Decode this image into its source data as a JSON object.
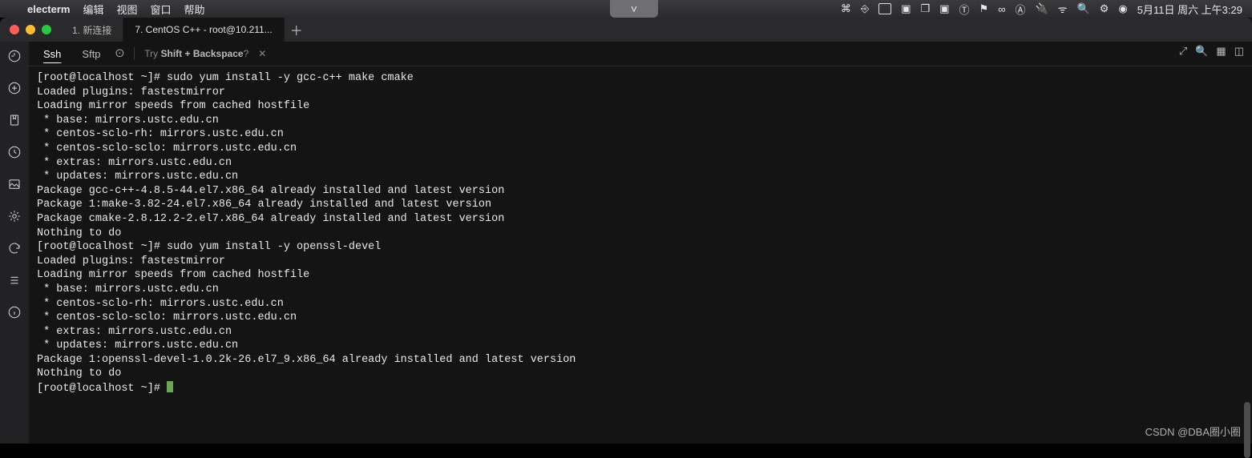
{
  "menubar": {
    "app_name": "electerm",
    "items": [
      "编辑",
      "视图",
      "窗口",
      "帮助"
    ],
    "datetime": "5月11日 周六 上午3:29"
  },
  "window": {
    "tabs": [
      {
        "label": "1. 新连接",
        "active": false
      },
      {
        "label": "7. CentOS C++ - root@10.211...",
        "active": true
      }
    ]
  },
  "toolbar": {
    "tabs": {
      "ssh": "Ssh",
      "sftp": "Sftp"
    },
    "hint_pre": "Try ",
    "hint_key": "Shift + Backspace",
    "hint_post": "?"
  },
  "terminal": {
    "lines": [
      "[root@localhost ~]# sudo yum install -y gcc-c++ make cmake",
      "Loaded plugins: fastestmirror",
      "Loading mirror speeds from cached hostfile",
      " * base: mirrors.ustc.edu.cn",
      " * centos-sclo-rh: mirrors.ustc.edu.cn",
      " * centos-sclo-sclo: mirrors.ustc.edu.cn",
      " * extras: mirrors.ustc.edu.cn",
      " * updates: mirrors.ustc.edu.cn",
      "Package gcc-c++-4.8.5-44.el7.x86_64 already installed and latest version",
      "Package 1:make-3.82-24.el7.x86_64 already installed and latest version",
      "Package cmake-2.8.12.2-2.el7.x86_64 already installed and latest version",
      "Nothing to do",
      "[root@localhost ~]# sudo yum install -y openssl-devel",
      "Loaded plugins: fastestmirror",
      "Loading mirror speeds from cached hostfile",
      " * base: mirrors.ustc.edu.cn",
      " * centos-sclo-rh: mirrors.ustc.edu.cn",
      " * centos-sclo-sclo: mirrors.ustc.edu.cn",
      " * extras: mirrors.ustc.edu.cn",
      " * updates: mirrors.ustc.edu.cn",
      "Package 1:openssl-devel-1.0.2k-26.el7_9.x86_64 already installed and latest version",
      "Nothing to do",
      "[root@localhost ~]# "
    ]
  },
  "watermark": "CSDN @DBA圈小圈"
}
